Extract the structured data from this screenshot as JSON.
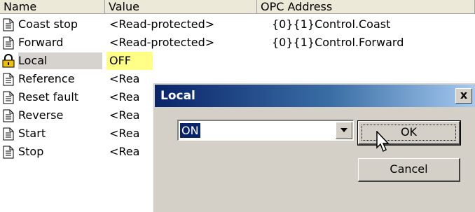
{
  "table": {
    "headers": {
      "name": "Name",
      "value": "Value",
      "address": "OPC Address"
    },
    "rows": [
      {
        "icon": "document-icon",
        "name": "Coast stop",
        "value": "<Read-protected>",
        "address": "{0}{1}Control.Coast"
      },
      {
        "icon": "document-icon",
        "name": "Forward",
        "value": "<Read-protected>",
        "address": "{0}{1}Control.Forward"
      },
      {
        "icon": "lock-icon",
        "name": "Local",
        "value": "OFF",
        "address": ""
      },
      {
        "icon": "document-icon",
        "name": "Reference",
        "value": "<Rea",
        "address": ""
      },
      {
        "icon": "document-icon",
        "name": "Reset fault",
        "value": "<Rea",
        "address": ""
      },
      {
        "icon": "document-icon",
        "name": "Reverse",
        "value": "<Rea",
        "address": ""
      },
      {
        "icon": "document-icon",
        "name": "Start",
        "value": "<Rea",
        "address": ""
      },
      {
        "icon": "document-icon",
        "name": "Stop",
        "value": "<Rea",
        "address": ""
      }
    ]
  },
  "dialog": {
    "title": "Local",
    "close_label": "x",
    "select_value": "ON",
    "ok_label": "OK",
    "cancel_label": "Cancel"
  },
  "colors": {
    "titlebar_start": "#0a246a",
    "titlebar_end": "#a6caf0",
    "value_highlight": "#ffff88",
    "dialog_face": "#d4d0c8"
  }
}
